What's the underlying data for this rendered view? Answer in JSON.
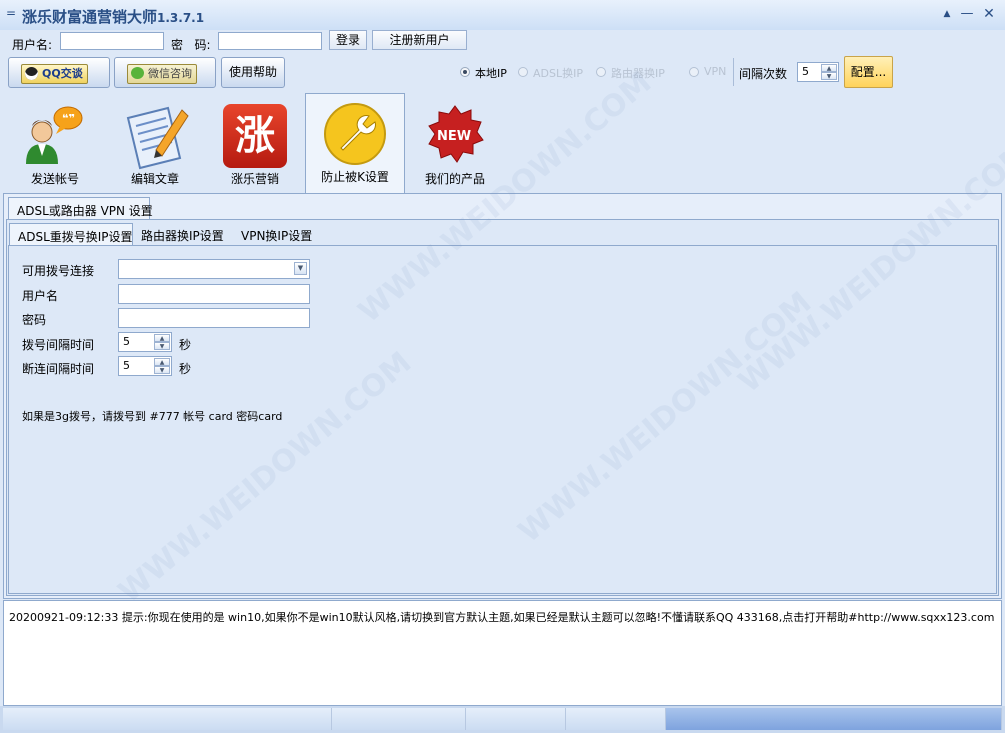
{
  "window": {
    "title": "涨乐财富通营销大师",
    "version": "1.3.7.1",
    "menu_glyph": "="
  },
  "login": {
    "username_label": "用户名:",
    "password_label": "密   码:",
    "username_value": "",
    "password_value": "",
    "login_button": "登录",
    "register_button": "注册新用户"
  },
  "toolbar": {
    "qq_button": "QQ交谈",
    "wechat_button": "微信咨询",
    "help_button": "使用帮助",
    "ip_options": [
      {
        "label": "本地IP",
        "selected": true,
        "enabled": true
      },
      {
        "label": "ADSL换IP",
        "selected": false,
        "enabled": false
      },
      {
        "label": "路由器换IP",
        "selected": false,
        "enabled": false
      },
      {
        "label": "VPN",
        "selected": false,
        "enabled": false
      }
    ],
    "interval_label": "间隔次数",
    "interval_value": "5",
    "config_button": "配置..."
  },
  "nav_tabs": [
    {
      "label": "发送帐号",
      "icon": "user-chat-icon",
      "active": false
    },
    {
      "label": "编辑文章",
      "icon": "edit-document-icon",
      "active": false
    },
    {
      "label": "涨乐营销",
      "icon": "zhangle-logo-icon",
      "active": false
    },
    {
      "label": "防止被K设置",
      "icon": "wrench-icon",
      "active": true
    },
    {
      "label": "我们的产品",
      "icon": "new-badge-icon",
      "active": false
    }
  ],
  "outer_tab": "ADSL或路由器 VPN 设置",
  "inner_tabs": [
    "ADSL重拨号换IP设置",
    "路由器换IP设置",
    "VPN换IP设置"
  ],
  "form": {
    "dial_connection_label": "可用拨号连接",
    "dial_connection_value": "",
    "username_label": "用户名",
    "username_value": "",
    "password_label": "密码",
    "password_value": "",
    "dial_interval_label": "拨号间隔时间",
    "dial_interval_value": "5",
    "dial_interval_unit": "秒",
    "disconnect_interval_label": "断连间隔时间",
    "disconnect_interval_value": "5",
    "disconnect_interval_unit": "秒",
    "note": "如果是3g拨号，请拨号到 #777 帐号 card 密码card"
  },
  "log": {
    "line": "20200921-09:12:33  提示:你现在使用的是 win10,如果你不是win10默认风格,请切换到官方默认主题,如果已经是默认主题可以忽略!不懂请联系QQ 433168,点击打开帮助#http://www.sqxx123.com"
  },
  "watermark": "WWW.WEIDOWN.COM",
  "colors": {
    "title_text": "#2a4f86",
    "background": "#dde8f7",
    "config_button": "#ffd35a"
  }
}
